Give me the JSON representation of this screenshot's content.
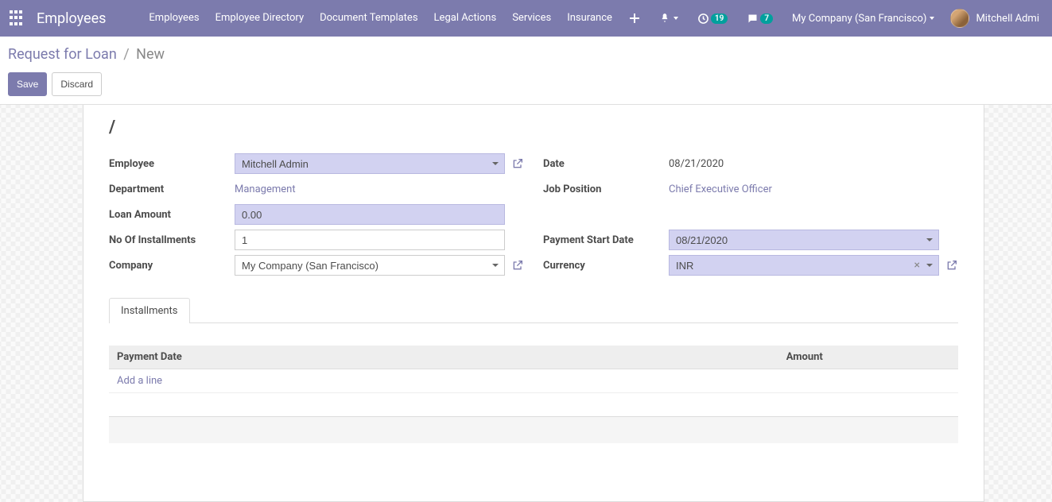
{
  "navbar": {
    "brand": "Employees",
    "menu": [
      "Employees",
      "Employee Directory",
      "Document Templates",
      "Legal Actions",
      "Services",
      "Insurance"
    ],
    "activities_count": "19",
    "messages_count": "7",
    "company": "My Company (San Francisco)",
    "user": "Mitchell Admi"
  },
  "breadcrumb": {
    "parent": "Request for Loan",
    "current": "New"
  },
  "buttons": {
    "save": "Save",
    "discard": "Discard"
  },
  "form": {
    "title": "/",
    "employee_label": "Employee",
    "employee_value": "Mitchell Admin",
    "department_label": "Department",
    "department_value": "Management",
    "loan_amount_label": "Loan Amount",
    "loan_amount_value": "0.00",
    "installments_label": "No Of Installments",
    "installments_value": "1",
    "company_label": "Company",
    "company_value": "My Company (San Francisco)",
    "date_label": "Date",
    "date_value": "08/21/2020",
    "job_label": "Job Position",
    "job_value": "Chief Executive Officer",
    "pay_start_label": "Payment Start Date",
    "pay_start_value": "08/21/2020",
    "currency_label": "Currency",
    "currency_value": "INR"
  },
  "tabs": {
    "installments": "Installments"
  },
  "table": {
    "col_date": "Payment Date",
    "col_amount": "Amount",
    "add_line": "Add a line"
  }
}
